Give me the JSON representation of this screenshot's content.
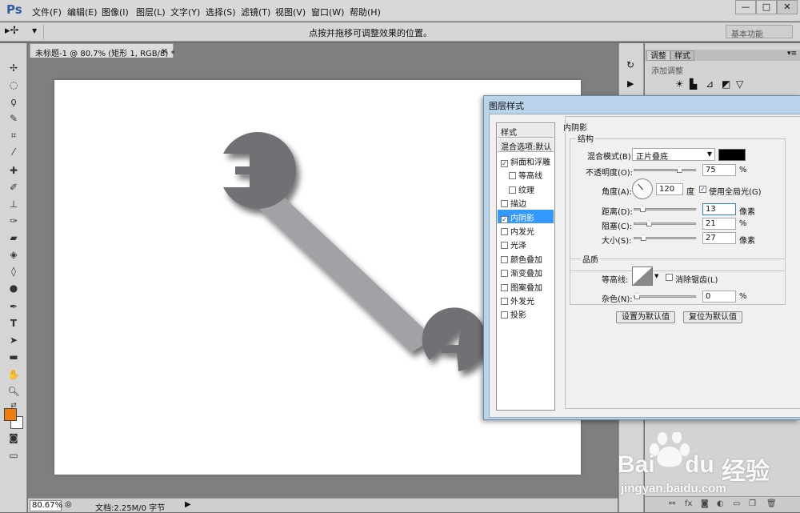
{
  "app": {
    "logo": "Ps"
  },
  "menu": [
    "文件(F)",
    "编辑(E)",
    "图像(I)",
    "图层(L)",
    "文字(Y)",
    "选择(S)",
    "滤镜(T)",
    "视图(V)",
    "窗口(W)",
    "帮助(H)"
  ],
  "window_controls": {
    "min": "—",
    "max": "□",
    "close": "✕"
  },
  "options": {
    "hint": "点按并拖移可调整效果的位置。",
    "workspace": "基本功能"
  },
  "document": {
    "tab_title": "未标题-1 @ 80.7% (矩形 1, RGB/8) *",
    "close": "×"
  },
  "status": {
    "zoom": "80.67%",
    "doc_info": "文档:2.25M/0 字节"
  },
  "panel": {
    "tabs": [
      "调整",
      "样式"
    ],
    "subtitle": "添加调整"
  },
  "dialog": {
    "title": "图层样式",
    "style_list": {
      "header_styles": "样式",
      "header_blend": "混合选项:默认",
      "items": [
        {
          "label": "斜面和浮雕",
          "checked": true
        },
        {
          "label": "等高线",
          "checked": false
        },
        {
          "label": "纹理",
          "checked": false
        },
        {
          "label": "描边",
          "checked": false
        },
        {
          "label": "内阴影",
          "checked": true
        },
        {
          "label": "内发光",
          "checked": false
        },
        {
          "label": "光泽",
          "checked": false
        },
        {
          "label": "颜色叠加",
          "checked": false
        },
        {
          "label": "渐变叠加",
          "checked": false
        },
        {
          "label": "图案叠加",
          "checked": false
        },
        {
          "label": "外发光",
          "checked": false
        },
        {
          "label": "投影",
          "checked": false
        }
      ]
    },
    "section_title": "内阴影",
    "structure": {
      "title": "结构",
      "blend_mode_label": "混合模式(B):",
      "blend_mode_value": "正片叠底",
      "opacity_label": "不透明度(O):",
      "opacity_value": "75",
      "opacity_level": 0.75,
      "percent": "%",
      "angle_label": "角度(A):",
      "angle_value": "120",
      "degree": "度",
      "global_light_label": "使用全局光(G)",
      "global_light_checked": true,
      "distance_label": "距离(D):",
      "distance_value": "13",
      "distance_level": 0.1,
      "pixels": "像素",
      "choke_label": "阻塞(C):",
      "choke_value": "21",
      "choke_level": 0.21,
      "size_label": "大小(S):",
      "size_value": "27",
      "size_level": 0.11
    },
    "quality": {
      "title": "品质",
      "contour_label": "等高线:",
      "antialias_label": "消除锯齿(L)",
      "antialias_checked": false,
      "noise_label": "杂色(N):",
      "noise_value": "0",
      "noise_level": 0
    },
    "buttons": {
      "make_default": "设置为默认值",
      "reset_default": "复位为默认值"
    }
  },
  "watermark": {
    "brand_a": "Bai",
    "brand_b": "du",
    "brand_cn": "经验",
    "url": "jingyan.baidu.com"
  },
  "colors": {
    "foreground": "#f07d10",
    "wrench_fill": "#727074",
    "wrench_handle": "#a3a1a6",
    "selection": "#3399ff"
  }
}
